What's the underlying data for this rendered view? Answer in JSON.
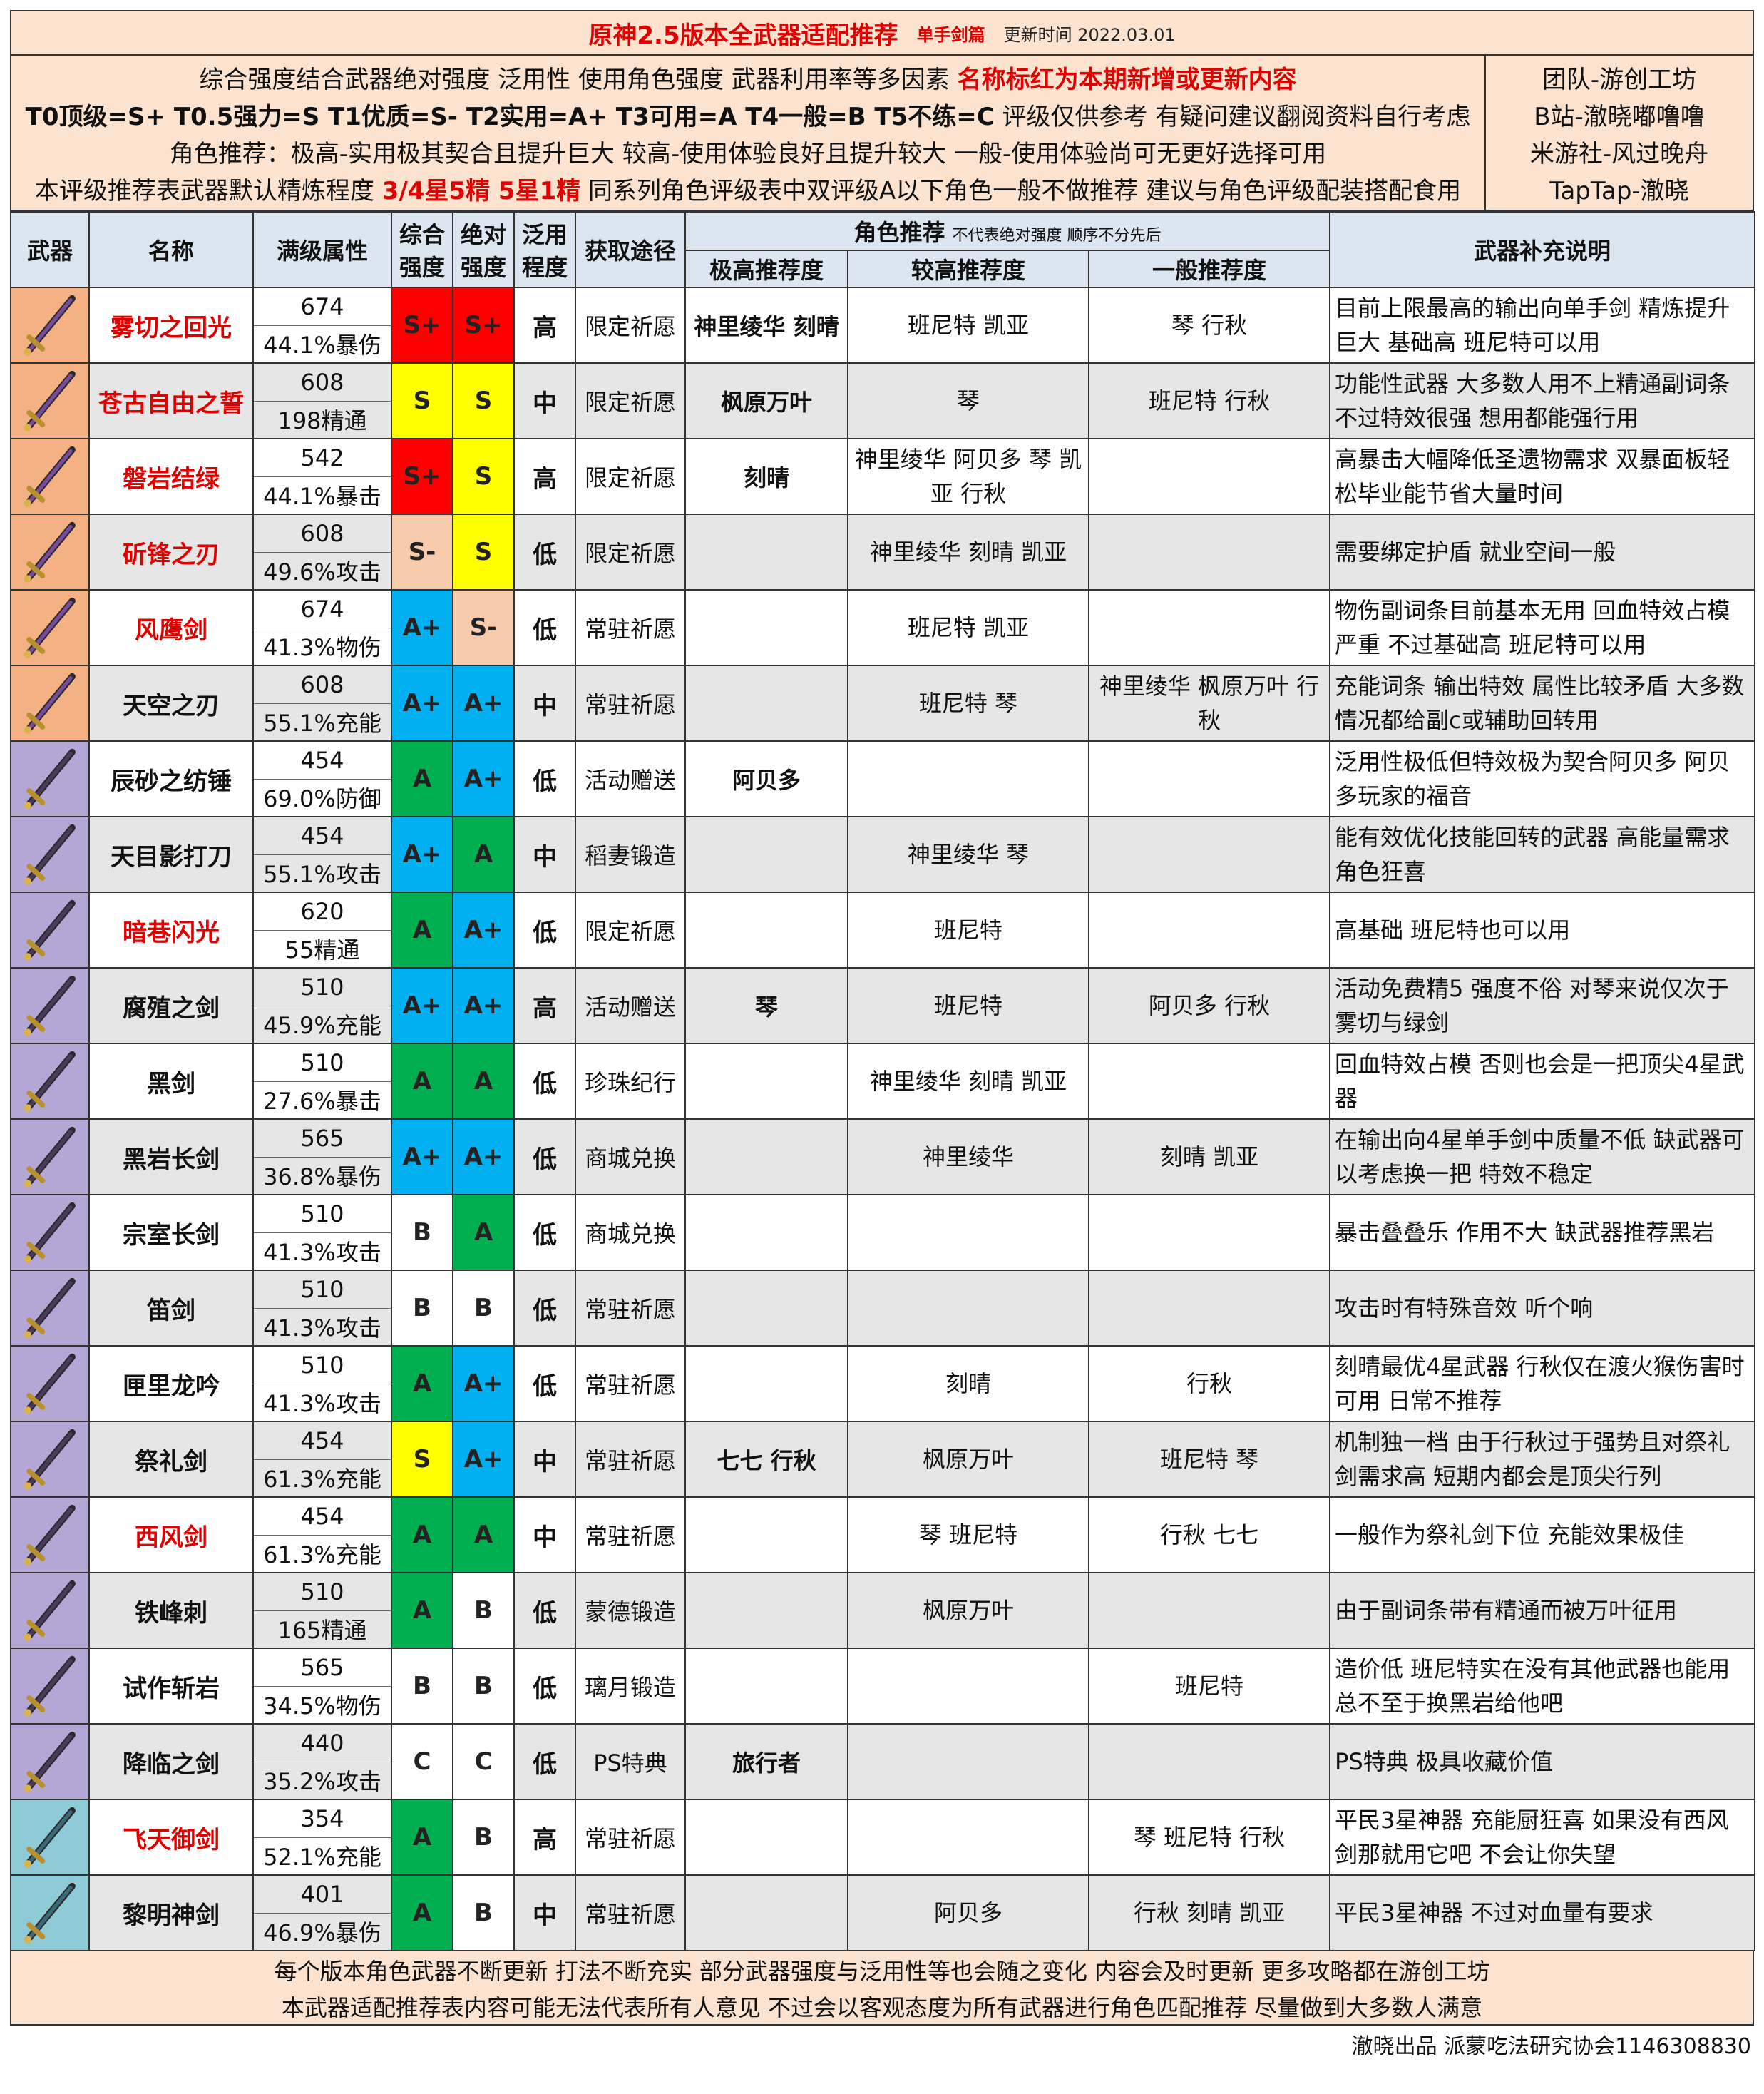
{
  "title": {
    "main": "原神2.5版本全武器适配推荐",
    "sub": "单手剑篇",
    "date": "更新时间 2022.03.01"
  },
  "info": {
    "line1_a": "综合强度结合武器绝对强度 泛用性 使用角色强度 武器利用率等多因素 ",
    "line1_red": "名称标红为本期新增或更新内容",
    "line2_bold": "T0顶级=S+ T0.5强力=S T1优质=S- T2实用=A+ T3可用=A T4一般=B T5不练=C",
    "line2_rest": " 评级仅供参考 有疑问建议翻阅资料自行考虑",
    "line3": "角色推荐：极高-实用极其契合且提升巨大 较高-使用体验良好且提升较大 一般-使用体验尚可无更好选择可用",
    "line4_a": "本评级推荐表武器默认精炼程度 ",
    "line4_red": "3/4星5精 5星1精",
    "line4_b": " 同系列角色评级表中双评级A以下角色一般不做推荐 建议与角色评级配装搭配食用"
  },
  "credits_box": [
    "团队-游创工坊",
    "B站-澈晓嘟噜噜",
    "米游社-风过晚舟",
    "TapTap-澈晓"
  ],
  "headers": {
    "weapon": "武器",
    "name": "名称",
    "stats": "满级属性",
    "overall_1": "综合",
    "overall_2": "强度",
    "absolute_1": "绝对",
    "absolute_2": "强度",
    "general_1": "泛用",
    "general_2": "程度",
    "source": "获取途径",
    "roles": "角色推荐",
    "roles_note": "不代表绝对强度 顺序不分先后",
    "very_high": "极高推荐度",
    "high": "较高推荐度",
    "normal": "一般推荐度",
    "notes": "武器补充说明"
  },
  "weapons": [
    {
      "icon": "sword-icon",
      "bg": "orange",
      "name": "雾切之回光",
      "red": true,
      "atk": "674",
      "sub": "44.1%暴伤",
      "overall": "S+",
      "absolute": "S+",
      "general": "高",
      "source": "限定祈愿",
      "very_high": "神里绫华 刻晴",
      "high": "班尼特 凯亚",
      "normal": "琴 行秋",
      "note": "目前上限最高的输出向单手剑 精炼提升巨大 基础高 班尼特可以用"
    },
    {
      "icon": "sword-icon",
      "bg": "orange",
      "name": "苍古自由之誓",
      "red": true,
      "atk": "608",
      "sub": "198精通",
      "overall": "S",
      "absolute": "S",
      "general": "中",
      "source": "限定祈愿",
      "very_high": "枫原万叶",
      "high": "琴",
      "normal": "班尼特 行秋",
      "note": "功能性武器 大多数人用不上精通副词条 不过特效很强 想用都能强行用"
    },
    {
      "icon": "sword-icon",
      "bg": "orange",
      "name": "磐岩结绿",
      "red": true,
      "atk": "542",
      "sub": "44.1%暴击",
      "overall": "S+",
      "absolute": "S",
      "general": "高",
      "source": "限定祈愿",
      "very_high": "刻晴",
      "high": "神里绫华 阿贝多 琴 凯亚 行秋",
      "normal": "",
      "note": "高暴击大幅降低圣遗物需求 双暴面板轻松毕业能节省大量时间"
    },
    {
      "icon": "sword-icon",
      "bg": "orange",
      "name": "斫锋之刃",
      "red": true,
      "atk": "608",
      "sub": "49.6%攻击",
      "overall": "S-",
      "absolute": "S",
      "general": "低",
      "source": "限定祈愿",
      "very_high": "",
      "high": "神里绫华 刻晴 凯亚",
      "normal": "",
      "note": "需要绑定护盾 就业空间一般"
    },
    {
      "icon": "sword-icon",
      "bg": "orange",
      "name": "风鹰剑",
      "red": true,
      "atk": "674",
      "sub": "41.3%物伤",
      "overall": "A+",
      "absolute": "S-",
      "general": "低",
      "source": "常驻祈愿",
      "very_high": "",
      "high": "班尼特 凯亚",
      "normal": "",
      "note": "物伤副词条目前基本无用 回血特效占模严重 不过基础高 班尼特可以用"
    },
    {
      "icon": "sword-icon",
      "bg": "orange",
      "name": "天空之刃",
      "red": false,
      "atk": "608",
      "sub": "55.1%充能",
      "overall": "A+",
      "absolute": "A+",
      "general": "中",
      "source": "常驻祈愿",
      "very_high": "",
      "high": "班尼特 琴",
      "normal": "神里绫华 枫原万叶 行秋",
      "note": "充能词条 输出特效 属性比较矛盾 大多数情况都给副c或辅助回转用"
    },
    {
      "icon": "sword-icon",
      "bg": "purple",
      "name": "辰砂之纺锤",
      "red": false,
      "atk": "454",
      "sub": "69.0%防御",
      "overall": "A",
      "absolute": "A+",
      "general": "低",
      "source": "活动赠送",
      "very_high": "阿贝多",
      "high": "",
      "normal": "",
      "note": "泛用性极低但特效极为契合阿贝多 阿贝多玩家的福音"
    },
    {
      "icon": "sword-icon",
      "bg": "purple",
      "name": "天目影打刀",
      "red": false,
      "atk": "454",
      "sub": "55.1%攻击",
      "overall": "A+",
      "absolute": "A",
      "general": "中",
      "source": "稻妻锻造",
      "very_high": "",
      "high": "神里绫华 琴",
      "normal": "",
      "note": "能有效优化技能回转的武器 高能量需求角色狂喜"
    },
    {
      "icon": "sword-icon",
      "bg": "purple",
      "name": "暗巷闪光",
      "red": true,
      "atk": "620",
      "sub": "55精通",
      "overall": "A",
      "absolute": "A+",
      "general": "低",
      "source": "限定祈愿",
      "very_high": "",
      "high": "班尼特",
      "normal": "",
      "note": "高基础 班尼特也可以用"
    },
    {
      "icon": "sword-icon",
      "bg": "purple",
      "name": "腐殖之剑",
      "red": false,
      "atk": "510",
      "sub": "45.9%充能",
      "overall": "A+",
      "absolute": "A+",
      "general": "高",
      "source": "活动赠送",
      "very_high": "琴",
      "high": "班尼特",
      "normal": "阿贝多 行秋",
      "note": "活动免费精5 强度不俗 对琴来说仅次于雾切与绿剑"
    },
    {
      "icon": "sword-icon",
      "bg": "purple",
      "name": "黑剑",
      "red": false,
      "atk": "510",
      "sub": "27.6%暴击",
      "overall": "A",
      "absolute": "A",
      "general": "低",
      "source": "珍珠纪行",
      "very_high": "",
      "high": "神里绫华 刻晴 凯亚",
      "normal": "",
      "note": "回血特效占模 否则也会是一把顶尖4星武器"
    },
    {
      "icon": "sword-icon",
      "bg": "purple",
      "name": "黑岩长剑",
      "red": false,
      "atk": "565",
      "sub": "36.8%暴伤",
      "overall": "A+",
      "absolute": "A+",
      "general": "低",
      "source": "商城兑换",
      "very_high": "",
      "high": "神里绫华",
      "normal": "刻晴 凯亚",
      "note": "在输出向4星单手剑中质量不低 缺武器可以考虑换一把 特效不稳定"
    },
    {
      "icon": "sword-icon",
      "bg": "purple",
      "name": "宗室长剑",
      "red": false,
      "atk": "510",
      "sub": "41.3%攻击",
      "overall": "B",
      "absolute": "A",
      "general": "低",
      "source": "商城兑换",
      "very_high": "",
      "high": "",
      "normal": "",
      "note": "暴击叠叠乐 作用不大 缺武器推荐黑岩"
    },
    {
      "icon": "sword-icon",
      "bg": "purple",
      "name": "笛剑",
      "red": false,
      "atk": "510",
      "sub": "41.3%攻击",
      "overall": "B",
      "absolute": "B",
      "general": "低",
      "source": "常驻祈愿",
      "very_high": "",
      "high": "",
      "normal": "",
      "note": "攻击时有特殊音效 听个响"
    },
    {
      "icon": "sword-icon",
      "bg": "purple",
      "name": "匣里龙吟",
      "red": false,
      "atk": "510",
      "sub": "41.3%攻击",
      "overall": "A",
      "absolute": "A+",
      "general": "低",
      "source": "常驻祈愿",
      "very_high": "",
      "high": "刻晴",
      "normal": "行秋",
      "note": "刻晴最优4星武器 行秋仅在渡火猴伤害时可用 日常不推荐"
    },
    {
      "icon": "sword-icon",
      "bg": "purple",
      "name": "祭礼剑",
      "red": false,
      "atk": "454",
      "sub": "61.3%充能",
      "overall": "S",
      "absolute": "A+",
      "general": "中",
      "source": "常驻祈愿",
      "very_high": "七七 行秋",
      "high": "枫原万叶",
      "normal": "班尼特 琴",
      "note": "机制独一档 由于行秋过于强势且对祭礼剑需求高 短期内都会是顶尖行列"
    },
    {
      "icon": "sword-icon",
      "bg": "purple",
      "name": "西风剑",
      "red": true,
      "atk": "454",
      "sub": "61.3%充能",
      "overall": "A",
      "absolute": "A",
      "general": "中",
      "source": "常驻祈愿",
      "very_high": "",
      "high": "琴 班尼特",
      "normal": "行秋 七七",
      "note": "一般作为祭礼剑下位 充能效果极佳"
    },
    {
      "icon": "sword-icon",
      "bg": "purple",
      "name": "铁峰刺",
      "red": false,
      "atk": "510",
      "sub": "165精通",
      "overall": "A",
      "absolute": "B",
      "general": "低",
      "source": "蒙德锻造",
      "very_high": "",
      "high": "枫原万叶",
      "normal": "",
      "note": "由于副词条带有精通而被万叶征用"
    },
    {
      "icon": "sword-icon",
      "bg": "purple",
      "name": "试作斩岩",
      "red": false,
      "atk": "565",
      "sub": "34.5%物伤",
      "overall": "B",
      "absolute": "B",
      "general": "低",
      "source": "璃月锻造",
      "very_high": "",
      "high": "",
      "normal": "班尼特",
      "note": "造价低 班尼特实在没有其他武器也能用 总不至于换黑岩给他吧"
    },
    {
      "icon": "sword-icon",
      "bg": "purple",
      "name": "降临之剑",
      "red": false,
      "atk": "440",
      "sub": "35.2%攻击",
      "overall": "C",
      "absolute": "C",
      "general": "低",
      "source": "PS特典",
      "very_high": "旅行者",
      "high": "",
      "normal": "",
      "note": "PS特典 极具收藏价值"
    },
    {
      "icon": "sword-icon",
      "bg": "blue",
      "name": "飞天御剑",
      "red": true,
      "atk": "354",
      "sub": "52.1%充能",
      "overall": "A",
      "absolute": "B",
      "general": "高",
      "source": "常驻祈愿",
      "very_high": "",
      "high": "",
      "normal": "琴 班尼特 行秋",
      "note": "平民3星神器 充能厨狂喜 如果没有西风剑那就用它吧 不会让你失望"
    },
    {
      "icon": "sword-icon",
      "bg": "blue",
      "name": "黎明神剑",
      "red": false,
      "atk": "401",
      "sub": "46.9%暴伤",
      "overall": "A",
      "absolute": "B",
      "general": "中",
      "source": "常驻祈愿",
      "very_high": "",
      "high": "阿贝多",
      "normal": "行秋 刻晴 凯亚",
      "note": "平民3星神器 不过对血量有要求"
    }
  ],
  "footer": {
    "line1": "每个版本角色武器不断更新 打法不断充实 部分武器强度与泛用性等也会随之变化 内容会及时更新 更多攻略都在游创工坊",
    "line2": "本武器适配推荐表内容可能无法代表所有人意见 不过会以客观态度为所有武器进行角色匹配推荐 尽量做到大多数人满意"
  },
  "credit": "澈晓出品 派蒙吃法研究协会1146308830",
  "colors": {
    "S+": "#ff0000",
    "S": "#ffff00",
    "S-": "#f8cbad",
    "A+": "#00b0f0",
    "A": "#00b050",
    "B": "#ffffff",
    "C": "#ffffff",
    "accent_red": "#e00000",
    "header_bg": "#dbe6f1",
    "info_bg": "#fbe3cf"
  }
}
